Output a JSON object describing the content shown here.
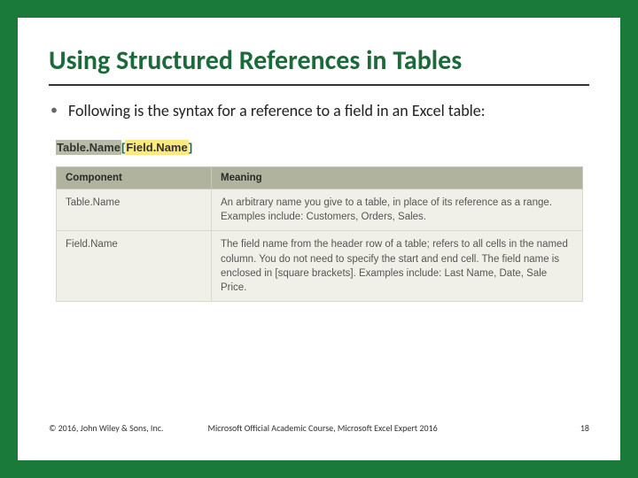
{
  "title": "Using Structured References in Tables",
  "bullet": "Following is the syntax for a reference to a field in an Excel table:",
  "syntax": {
    "table": "Table.Name",
    "lbracket": "[",
    "field": "Field.Name",
    "rbracket": "]"
  },
  "table": {
    "head_component": "Component",
    "head_meaning": "Meaning",
    "rows": [
      {
        "component": "Table.Name",
        "meaning": "An arbitrary name you give to a table, in place of its reference as a range. Examples include: Customers, Orders, Sales."
      },
      {
        "component": "Field.Name",
        "meaning": "The field name from the header row of a table; refers to all cells in the named column. You do not need to specify the start and end cell. The field name is enclosed in [square brackets]. Examples include: Last Name, Date, Sale Price."
      }
    ]
  },
  "footer": {
    "left": "© 2016, John Wiley & Sons, Inc.",
    "mid": "Microsoft Official Academic Course, Microsoft Excel Expert 2016",
    "right": "18"
  }
}
